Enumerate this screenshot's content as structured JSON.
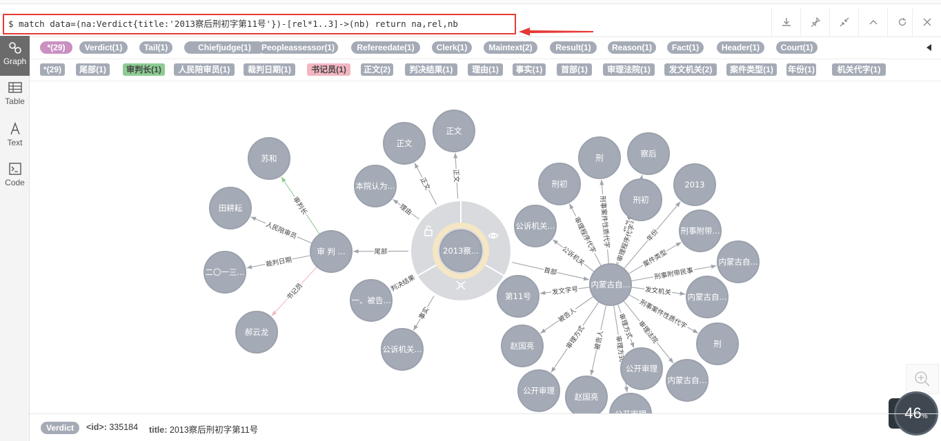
{
  "command": "$ match data=(na:Verdict{title:'2013察后刑初字第11号'})-[rel*1..3]->(nb) return na,rel,nb",
  "toolbar": [
    "download-icon",
    "pin-icon",
    "collapse-icon",
    "up-icon",
    "refresh-icon",
    "close-icon"
  ],
  "sidebar": [
    {
      "label": "Graph",
      "icon": "graph-icon",
      "active": true
    },
    {
      "label": "Table",
      "icon": "table-icon",
      "active": false
    },
    {
      "label": "Text",
      "icon": "text-icon",
      "active": false
    },
    {
      "label": "Code",
      "icon": "code-icon",
      "active": false
    }
  ],
  "labels_row": [
    {
      "text": "*(29)",
      "color": "pink"
    },
    {
      "text": "Verdict(1)"
    },
    {
      "text": "Tail(1)"
    },
    {
      "text": "Chiefjudge(1)"
    },
    {
      "text": "Peopleassessor(1)"
    },
    {
      "text": "Refereedate(1)"
    },
    {
      "text": "Clerk(1)"
    },
    {
      "text": "Maintext(2)"
    },
    {
      "text": "Result(1)"
    },
    {
      "text": "Reason(1)"
    },
    {
      "text": "Fact(1)"
    },
    {
      "text": "Header(1)"
    },
    {
      "text": "Court(1)"
    }
  ],
  "rels_row": [
    {
      "text": "*(29)"
    },
    {
      "text": "尾部(1)"
    },
    {
      "text": "审判长(1)",
      "color": "green"
    },
    {
      "text": "人民陪审员(1)"
    },
    {
      "text": "裁判日期(1)"
    },
    {
      "text": "书记员(1)",
      "color": "pink"
    },
    {
      "text": "正文(2)"
    },
    {
      "text": "判决结果(1)"
    },
    {
      "text": "理由(1)"
    },
    {
      "text": "事实(1)"
    },
    {
      "text": "首部(1)"
    },
    {
      "text": "审理法院(1)"
    },
    {
      "text": "发文机关(2)"
    },
    {
      "text": "案件类型(1)"
    },
    {
      "text": "年份(1)"
    },
    {
      "text": "机关代字(1)"
    }
  ],
  "graph": {
    "nodes": [
      {
        "id": "root",
        "label": "2013察..."
      },
      {
        "id": "tail",
        "label": "审  判  ..."
      },
      {
        "id": "suhe",
        "label": "苏和"
      },
      {
        "id": "tian",
        "label": "田耕耘"
      },
      {
        "id": "date",
        "label": "二〇一三..."
      },
      {
        "id": "hao",
        "label": "郝云龙"
      },
      {
        "id": "zw1",
        "label": "正文"
      },
      {
        "id": "zw2",
        "label": "正文"
      },
      {
        "id": "reason",
        "label": "本院认为..."
      },
      {
        "id": "result",
        "label": "一、被告..."
      },
      {
        "id": "fact",
        "label": "公诉机关..."
      },
      {
        "id": "header",
        "label": "内蒙古自..."
      },
      {
        "id": "no11",
        "label": "第11号"
      },
      {
        "id": "gs1",
        "label": "公诉机关..."
      },
      {
        "id": "xc1",
        "label": "刑初"
      },
      {
        "id": "xing1",
        "label": "刑"
      },
      {
        "id": "chah",
        "label": "察后"
      },
      {
        "id": "xc2",
        "label": "刑初"
      },
      {
        "id": "y2013",
        "label": "2013"
      },
      {
        "id": "xsfd",
        "label": "刑事附带..."
      },
      {
        "id": "nm1",
        "label": "内蒙古自..."
      },
      {
        "id": "nm2",
        "label": "内蒙古自..."
      },
      {
        "id": "xing2",
        "label": "刑"
      },
      {
        "id": "nm3",
        "label": "内蒙古自..."
      },
      {
        "id": "gksl1",
        "label": "公开审理"
      },
      {
        "id": "gksl2",
        "label": "公开审理"
      },
      {
        "id": "zgl1",
        "label": "赵国亮"
      },
      {
        "id": "zgl2",
        "label": "赵国亮"
      },
      {
        "id": "gksl3",
        "label": "公开审理"
      }
    ],
    "edges": [
      {
        "from": "tail",
        "to": "suhe",
        "label": "审判长",
        "color": "green"
      },
      {
        "from": "tail",
        "to": "tian",
        "label": "人民陪审员"
      },
      {
        "from": "tail",
        "to": "date",
        "label": "裁判日期"
      },
      {
        "from": "tail",
        "to": "hao",
        "label": "书记员",
        "color": "pink"
      },
      {
        "from": "root",
        "to": "tail",
        "label": "尾部"
      },
      {
        "from": "root",
        "to": "zw1",
        "label": "正文"
      },
      {
        "from": "root",
        "to": "zw2",
        "label": "正文"
      },
      {
        "from": "root",
        "to": "reason",
        "label": "理由"
      },
      {
        "from": "root",
        "to": "result",
        "label": "判决结果"
      },
      {
        "from": "root",
        "to": "fact",
        "label": "事实"
      },
      {
        "from": "root",
        "to": "header",
        "label": "首部"
      },
      {
        "from": "header",
        "to": "no11",
        "label": "发文字号"
      },
      {
        "from": "header",
        "to": "gs1",
        "label": "公诉机关"
      },
      {
        "from": "header",
        "to": "xc1",
        "label": "审理程序代字"
      },
      {
        "from": "header",
        "to": "xing1",
        "label": "刑事案件性质代字"
      },
      {
        "from": "header",
        "to": "chah",
        "label": "机关代字"
      },
      {
        "from": "header",
        "to": "xc2",
        "label": "审理程序代字"
      },
      {
        "from": "header",
        "to": "y2013",
        "label": "年份"
      },
      {
        "from": "header",
        "to": "xsfd",
        "label": "案件类型"
      },
      {
        "from": "header",
        "to": "nm1",
        "label": "刑事附带民事"
      },
      {
        "from": "header",
        "to": "nm2",
        "label": "发文机关"
      },
      {
        "from": "header",
        "to": "xing2",
        "label": "刑事案件性质代字"
      },
      {
        "from": "header",
        "to": "nm3",
        "label": "审理法院"
      },
      {
        "from": "header",
        "to": "gksl1",
        "label": "审理方式"
      },
      {
        "from": "header",
        "to": "gksl2",
        "label": "审理方式"
      },
      {
        "from": "header",
        "to": "zgl1",
        "label": "被告人"
      },
      {
        "from": "header",
        "to": "zgl2",
        "label": "被告人"
      },
      {
        "from": "header",
        "to": "gksl3",
        "label": "审理方式"
      }
    ]
  },
  "footer": {
    "tag": "Verdict",
    "id_key": "<id>:",
    "id_val": "335184",
    "title_key": "title:",
    "title_val": "2013察后刑初字第11号"
  },
  "gauge": {
    "value": "46",
    "unit": "%"
  },
  "colors": {
    "node": "#a5abb6",
    "edge": "#a0a4ab",
    "ring": "#d2d4d8",
    "ring_accent": "#f5e6c4",
    "red": "#e53935"
  }
}
